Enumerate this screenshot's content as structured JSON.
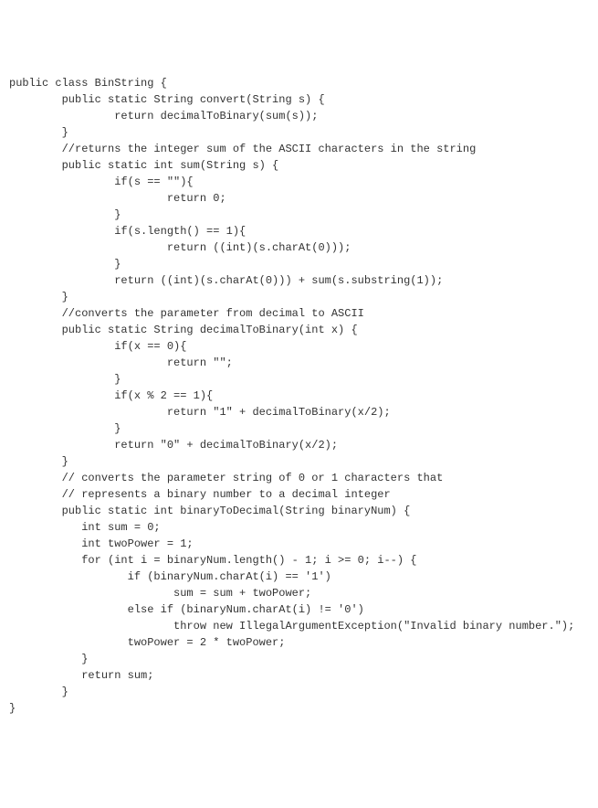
{
  "code": {
    "lines": [
      "public class BinString {",
      "",
      "        public static String convert(String s) {",
      "                return decimalToBinary(sum(s));",
      "        }",
      "",
      "        //returns the integer sum of the ASCII characters in the string",
      "        public static int sum(String s) {",
      "                if(s == \"\"){",
      "                        return 0;",
      "                }",
      "                if(s.length() == 1){",
      "                        return ((int)(s.charAt(0)));",
      "                }",
      "",
      "                return ((int)(s.charAt(0))) + sum(s.substring(1));",
      "        }",
      "",
      "        //converts the parameter from decimal to ASCII",
      "        public static String decimalToBinary(int x) {",
      "                if(x == 0){",
      "                        return \"\";",
      "                }",
      "                if(x % 2 == 1){",
      "                        return \"1\" + decimalToBinary(x/2);",
      "                }",
      "                return \"0\" + decimalToBinary(x/2);",
      "        }",
      "",
      "        // converts the parameter string of 0 or 1 characters that",
      "        // represents a binary number to a decimal integer",
      "        public static int binaryToDecimal(String binaryNum) {",
      "           int sum = 0;",
      "           int twoPower = 1;",
      "",
      "           for (int i = binaryNum.length() - 1; i >= 0; i--) {",
      "                  if (binaryNum.charAt(i) == '1')",
      "                         sum = sum + twoPower;",
      "                  else if (binaryNum.charAt(i) != '0')",
      "                         throw new IllegalArgumentException(\"Invalid binary number.\");",
      "                  twoPower = 2 * twoPower;",
      "           }",
      "           return sum;",
      "        }",
      "}"
    ]
  }
}
